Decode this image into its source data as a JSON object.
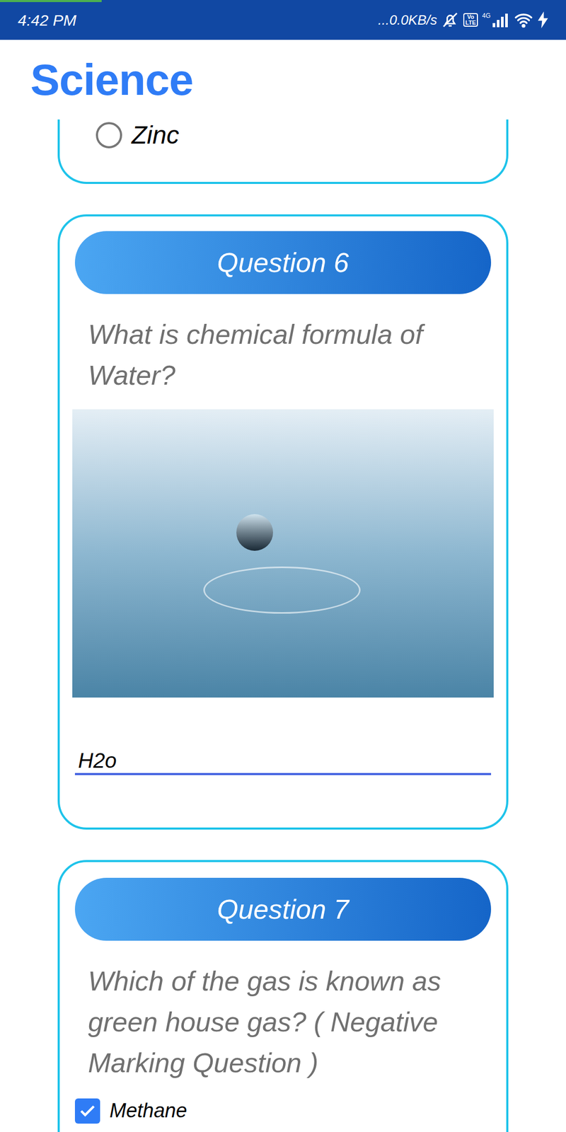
{
  "status_bar": {
    "time": "4:42 PM",
    "net_speed": "...0.0KB/s",
    "volte": [
      "Vo",
      "LTE"
    ],
    "network": "4G",
    "load_progress": 0.18
  },
  "app_bar": {
    "title": "Science"
  },
  "questions": [
    {
      "kind": "radio-tail",
      "options": [
        {
          "label": "Zinc",
          "selected": false
        }
      ]
    },
    {
      "kind": "text",
      "title": "Question 6",
      "text": "What is chemical formula of Water?",
      "image": true,
      "answer": "H2o",
      "focused": true
    },
    {
      "kind": "checkbox",
      "title": "Question 7",
      "text": "Which of the gas is known as green house gas? ( Negative Marking Question )",
      "options": [
        {
          "label": "Methane",
          "checked": true
        }
      ]
    }
  ]
}
